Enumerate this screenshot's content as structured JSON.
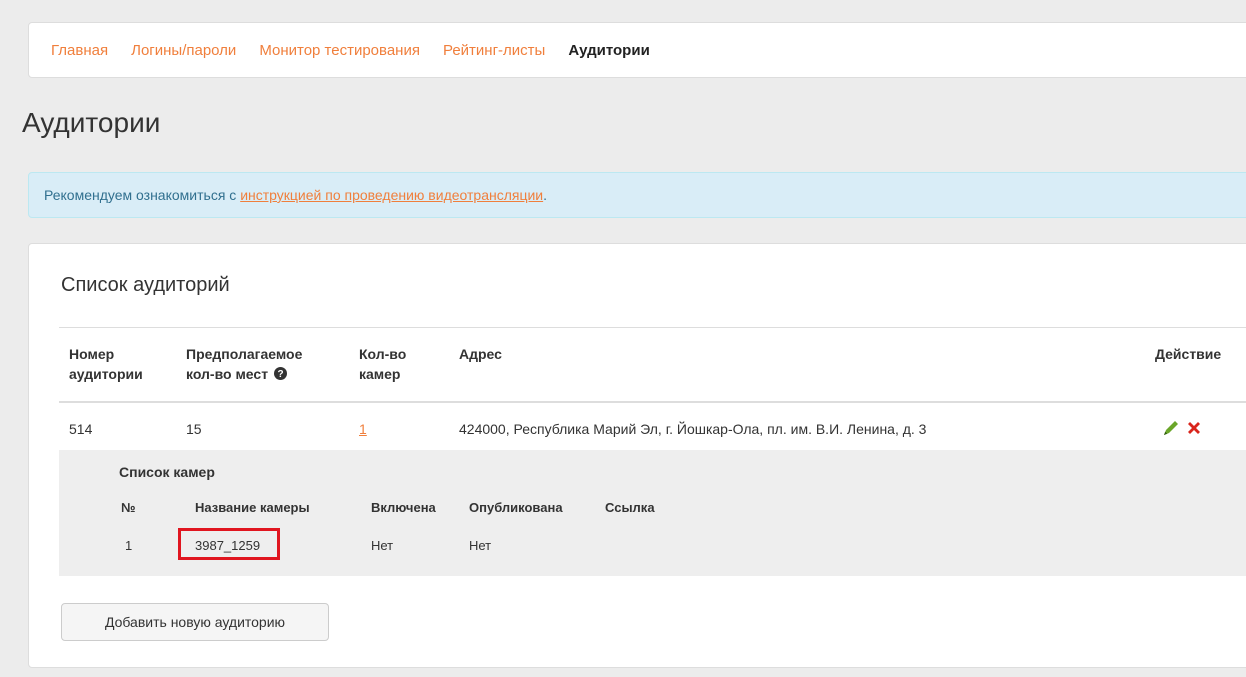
{
  "nav": {
    "items": [
      {
        "label": "Главная"
      },
      {
        "label": "Логины/пароли"
      },
      {
        "label": "Монитор тестирования"
      },
      {
        "label": "Рейтинг-листы"
      },
      {
        "label": "Аудитории"
      }
    ],
    "active_index": 4
  },
  "page_title": "Аудитории",
  "alert": {
    "text_before": "Рекомендуем ознакомиться с ",
    "link_text": "инструкцией по проведению видеотрансляции",
    "text_after": "."
  },
  "panel": {
    "title": "Список аудиторий",
    "columns": {
      "room_number_line1": "Номер",
      "room_number_line2": "аудитории",
      "seats_line1": "Предполагаемое",
      "seats_line2": "кол-во мест",
      "cameras_line1": "Кол-во",
      "cameras_line2": "камер",
      "address": "Адрес",
      "actions": "Действие"
    },
    "rows": [
      {
        "room_number": "514",
        "seats": "15",
        "cameras_count": "1",
        "address": "424000, Республика Марий Эл, г. Йошкар-Ола, пл. им. В.И. Ленина, д. 3"
      }
    ],
    "camera_list": {
      "title": "Список камер",
      "columns": {
        "number": "№",
        "name": "Название камеры",
        "enabled": "Включена",
        "published": "Опубликована",
        "link": "Ссылка"
      },
      "rows": [
        {
          "number": "1",
          "name": "3987_1259",
          "enabled": "Нет",
          "published": "Нет",
          "link": ""
        }
      ]
    },
    "add_button": "Добавить новую аудиторию"
  },
  "colors": {
    "accent_link": "#f07f3c",
    "alert_bg": "#d9edf7",
    "alert_text": "#31708f",
    "edit_icon": "#6aa629",
    "delete_icon": "#d9251c",
    "highlight_border": "#e0151f"
  },
  "icons": {
    "help": "question-circle-icon",
    "edit": "pencil-icon",
    "delete": "cross-icon"
  }
}
